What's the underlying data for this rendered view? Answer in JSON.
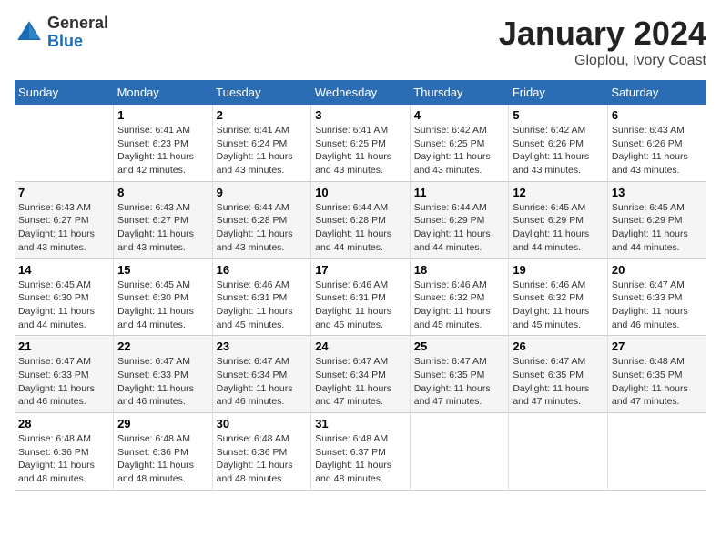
{
  "header": {
    "logo_general": "General",
    "logo_blue": "Blue",
    "title": "January 2024",
    "subtitle": "Gloplou, Ivory Coast"
  },
  "weekdays": [
    "Sunday",
    "Monday",
    "Tuesday",
    "Wednesday",
    "Thursday",
    "Friday",
    "Saturday"
  ],
  "weeks": [
    [
      {
        "day": "",
        "info": ""
      },
      {
        "day": "1",
        "info": "Sunrise: 6:41 AM\nSunset: 6:23 PM\nDaylight: 11 hours\nand 42 minutes."
      },
      {
        "day": "2",
        "info": "Sunrise: 6:41 AM\nSunset: 6:24 PM\nDaylight: 11 hours\nand 43 minutes."
      },
      {
        "day": "3",
        "info": "Sunrise: 6:41 AM\nSunset: 6:25 PM\nDaylight: 11 hours\nand 43 minutes."
      },
      {
        "day": "4",
        "info": "Sunrise: 6:42 AM\nSunset: 6:25 PM\nDaylight: 11 hours\nand 43 minutes."
      },
      {
        "day": "5",
        "info": "Sunrise: 6:42 AM\nSunset: 6:26 PM\nDaylight: 11 hours\nand 43 minutes."
      },
      {
        "day": "6",
        "info": "Sunrise: 6:43 AM\nSunset: 6:26 PM\nDaylight: 11 hours\nand 43 minutes."
      }
    ],
    [
      {
        "day": "7",
        "info": "Sunrise: 6:43 AM\nSunset: 6:27 PM\nDaylight: 11 hours\nand 43 minutes."
      },
      {
        "day": "8",
        "info": "Sunrise: 6:43 AM\nSunset: 6:27 PM\nDaylight: 11 hours\nand 43 minutes."
      },
      {
        "day": "9",
        "info": "Sunrise: 6:44 AM\nSunset: 6:28 PM\nDaylight: 11 hours\nand 43 minutes."
      },
      {
        "day": "10",
        "info": "Sunrise: 6:44 AM\nSunset: 6:28 PM\nDaylight: 11 hours\nand 44 minutes."
      },
      {
        "day": "11",
        "info": "Sunrise: 6:44 AM\nSunset: 6:29 PM\nDaylight: 11 hours\nand 44 minutes."
      },
      {
        "day": "12",
        "info": "Sunrise: 6:45 AM\nSunset: 6:29 PM\nDaylight: 11 hours\nand 44 minutes."
      },
      {
        "day": "13",
        "info": "Sunrise: 6:45 AM\nSunset: 6:29 PM\nDaylight: 11 hours\nand 44 minutes."
      }
    ],
    [
      {
        "day": "14",
        "info": "Sunrise: 6:45 AM\nSunset: 6:30 PM\nDaylight: 11 hours\nand 44 minutes."
      },
      {
        "day": "15",
        "info": "Sunrise: 6:45 AM\nSunset: 6:30 PM\nDaylight: 11 hours\nand 44 minutes."
      },
      {
        "day": "16",
        "info": "Sunrise: 6:46 AM\nSunset: 6:31 PM\nDaylight: 11 hours\nand 45 minutes."
      },
      {
        "day": "17",
        "info": "Sunrise: 6:46 AM\nSunset: 6:31 PM\nDaylight: 11 hours\nand 45 minutes."
      },
      {
        "day": "18",
        "info": "Sunrise: 6:46 AM\nSunset: 6:32 PM\nDaylight: 11 hours\nand 45 minutes."
      },
      {
        "day": "19",
        "info": "Sunrise: 6:46 AM\nSunset: 6:32 PM\nDaylight: 11 hours\nand 45 minutes."
      },
      {
        "day": "20",
        "info": "Sunrise: 6:47 AM\nSunset: 6:33 PM\nDaylight: 11 hours\nand 46 minutes."
      }
    ],
    [
      {
        "day": "21",
        "info": "Sunrise: 6:47 AM\nSunset: 6:33 PM\nDaylight: 11 hours\nand 46 minutes."
      },
      {
        "day": "22",
        "info": "Sunrise: 6:47 AM\nSunset: 6:33 PM\nDaylight: 11 hours\nand 46 minutes."
      },
      {
        "day": "23",
        "info": "Sunrise: 6:47 AM\nSunset: 6:34 PM\nDaylight: 11 hours\nand 46 minutes."
      },
      {
        "day": "24",
        "info": "Sunrise: 6:47 AM\nSunset: 6:34 PM\nDaylight: 11 hours\nand 47 minutes."
      },
      {
        "day": "25",
        "info": "Sunrise: 6:47 AM\nSunset: 6:35 PM\nDaylight: 11 hours\nand 47 minutes."
      },
      {
        "day": "26",
        "info": "Sunrise: 6:47 AM\nSunset: 6:35 PM\nDaylight: 11 hours\nand 47 minutes."
      },
      {
        "day": "27",
        "info": "Sunrise: 6:48 AM\nSunset: 6:35 PM\nDaylight: 11 hours\nand 47 minutes."
      }
    ],
    [
      {
        "day": "28",
        "info": "Sunrise: 6:48 AM\nSunset: 6:36 PM\nDaylight: 11 hours\nand 48 minutes."
      },
      {
        "day": "29",
        "info": "Sunrise: 6:48 AM\nSunset: 6:36 PM\nDaylight: 11 hours\nand 48 minutes."
      },
      {
        "day": "30",
        "info": "Sunrise: 6:48 AM\nSunset: 6:36 PM\nDaylight: 11 hours\nand 48 minutes."
      },
      {
        "day": "31",
        "info": "Sunrise: 6:48 AM\nSunset: 6:37 PM\nDaylight: 11 hours\nand 48 minutes."
      },
      {
        "day": "",
        "info": ""
      },
      {
        "day": "",
        "info": ""
      },
      {
        "day": "",
        "info": ""
      }
    ]
  ]
}
